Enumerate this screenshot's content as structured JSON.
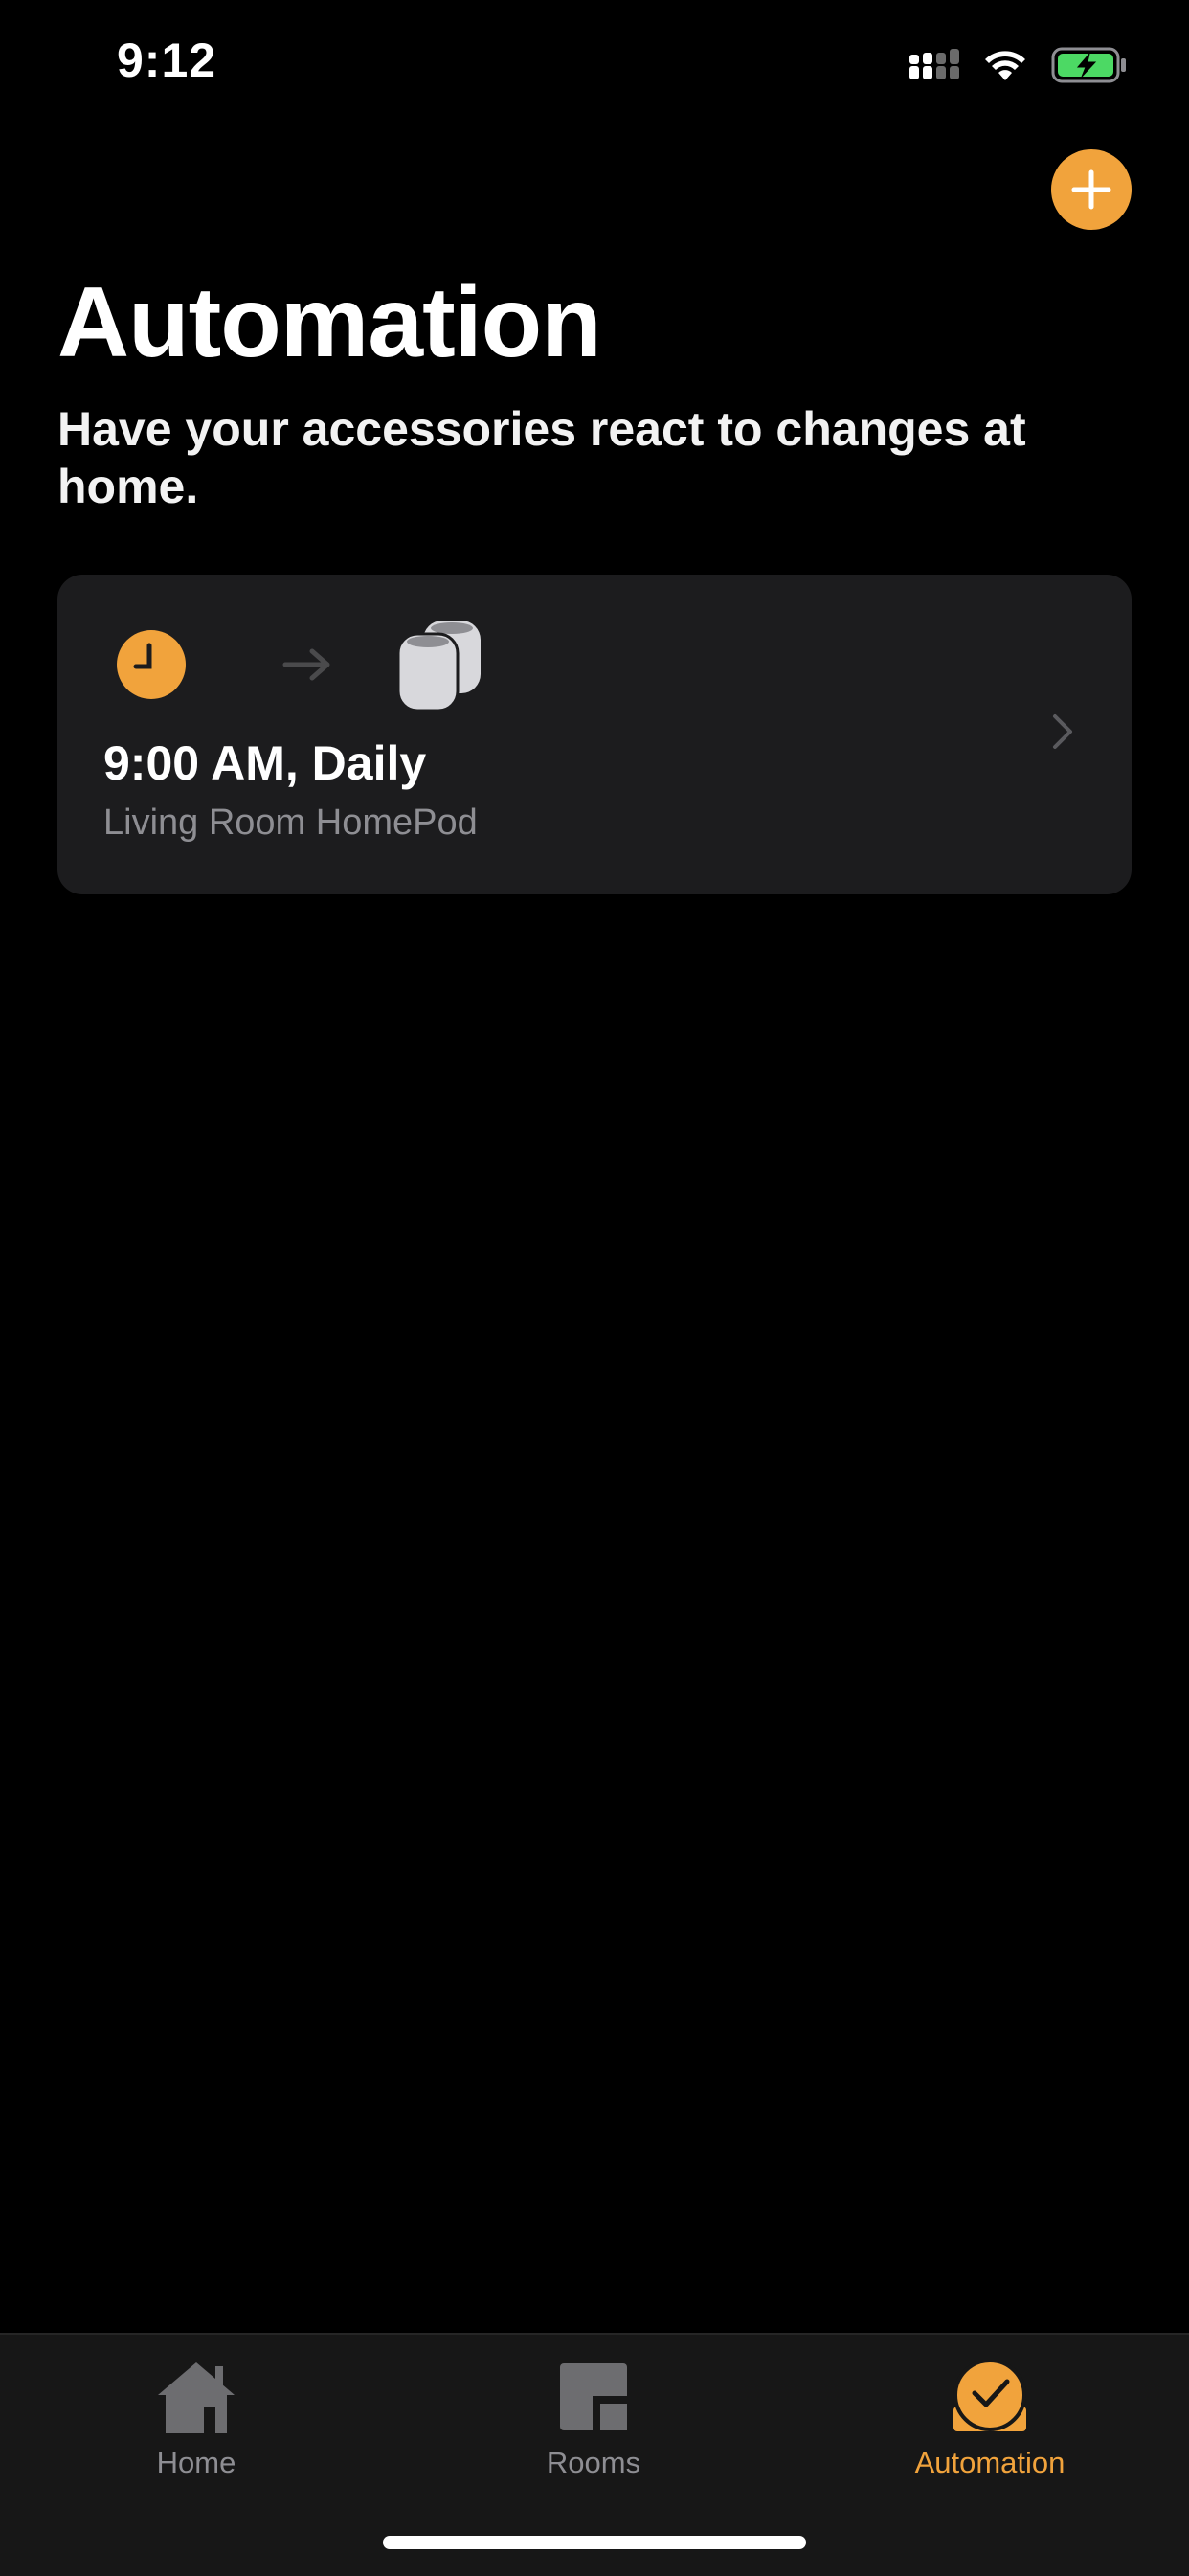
{
  "status_bar": {
    "time": "9:12",
    "icons": [
      "signal-icon",
      "wifi-icon",
      "battery-charging-icon"
    ]
  },
  "header": {
    "add_icon": "plus-icon",
    "title": "Automation",
    "subtitle": "Have your accessories react to changes at home."
  },
  "automations": [
    {
      "trigger_icon": "clock-icon",
      "action_icon": "homepod-icon",
      "title": "9:00 AM, Daily",
      "subtitle": "Living Room HomePod"
    }
  ],
  "tab_bar": {
    "tabs": [
      {
        "label": "Home",
        "icon": "house-icon",
        "active": false
      },
      {
        "label": "Rooms",
        "icon": "rooms-icon",
        "active": false
      },
      {
        "label": "Automation",
        "icon": "automation-clock-icon",
        "active": true
      }
    ]
  },
  "colors": {
    "accent": "#f1a33c",
    "background": "#000000",
    "card": "#1c1c1e",
    "secondary_text": "#8e8e93",
    "battery": "#4cd964"
  }
}
